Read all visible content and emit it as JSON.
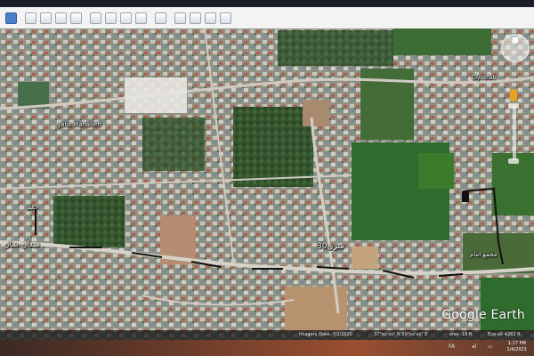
{
  "toolbar": {
    "buttons": [
      "sidebar-toggle",
      "add-placemark",
      "add-polygon",
      "add-path",
      "add-image-overlay",
      "record-tour",
      "show-historical-imagery",
      "show-sunlight",
      "switch-to-sky",
      "measure-ruler",
      "email",
      "print",
      "save-image",
      "view-in-google-maps"
    ]
  },
  "map": {
    "labels": {
      "place_top_right": "Ciyoshab",
      "place_left": "Jalis Mahalleh",
      "roadsign_left": "میدان نماز",
      "roadsign_center": "30متری",
      "roadsign_right": "مجمع امام",
      "street_left_vertical": "حکیم",
      "logo_text": "Google Earth"
    },
    "colors": {
      "road_marking": "#111111",
      "field_green": "#2f6b2c",
      "urban_base": "#9a9a8f"
    }
  },
  "statusbar": {
    "imagery_date": "Imagery Date: 7/2/2020",
    "coordinates": "37°xx'xx\" N  50°xx'xx\" E",
    "elevation": "elev  -18 ft",
    "eye_alt": "Eye alt  4262 ft"
  },
  "taskbar": {
    "language": "FA",
    "time": "1:17 PM",
    "date": "1/4/2021"
  }
}
